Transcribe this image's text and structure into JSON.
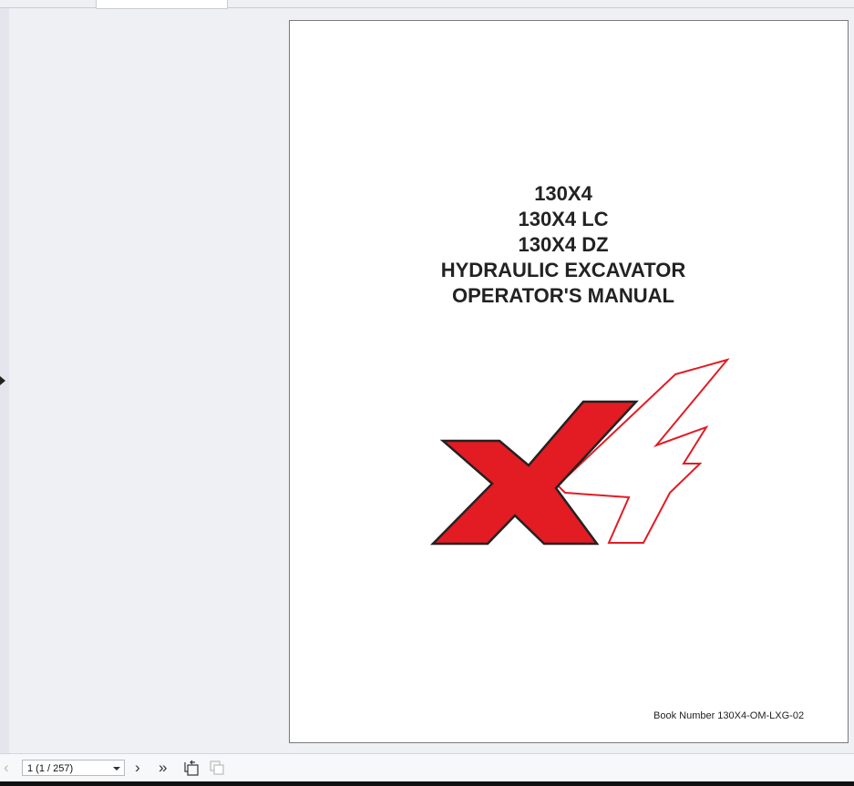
{
  "document": {
    "title_lines": [
      "130X4",
      "130X4 LC",
      "130X4 DZ",
      "HYDRAULIC EXCAVATOR",
      "OPERATOR'S MANUAL"
    ],
    "book_number": "Book Number 130X4-OM-LXG-02",
    "logo_text": "X4",
    "logo_colors": {
      "red": "#e31b23",
      "outline": "#222222"
    }
  },
  "toolbar": {
    "page_select_value": "1 (1 / 257)"
  }
}
